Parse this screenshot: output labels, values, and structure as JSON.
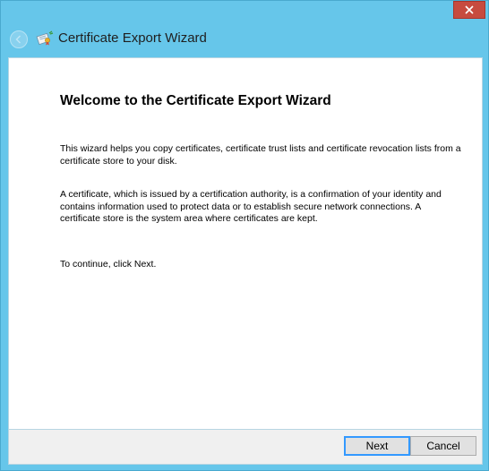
{
  "window": {
    "title": "Certificate Export Wizard",
    "close_symbol": "✕"
  },
  "icons": {
    "back": "back-arrow-icon",
    "wizard": "certificate-icon",
    "close": "close-icon"
  },
  "main": {
    "heading": "Welcome to the Certificate Export Wizard",
    "paragraphs": [
      "This wizard helps you copy certificates, certificate trust lists and certificate revocation lists from a certificate store to your disk.",
      "A certificate, which is issued by a certification authority, is a confirmation of your identity and contains information used to protect data or to establish secure network connections. A certificate store is the system area where certificates are kept.",
      "To continue, click Next."
    ]
  },
  "footer": {
    "next_label": "Next",
    "cancel_label": "Cancel"
  },
  "colors": {
    "frame": "#66c6ea",
    "close_button": "#c74b3f",
    "default_button_border": "#3399ff"
  }
}
